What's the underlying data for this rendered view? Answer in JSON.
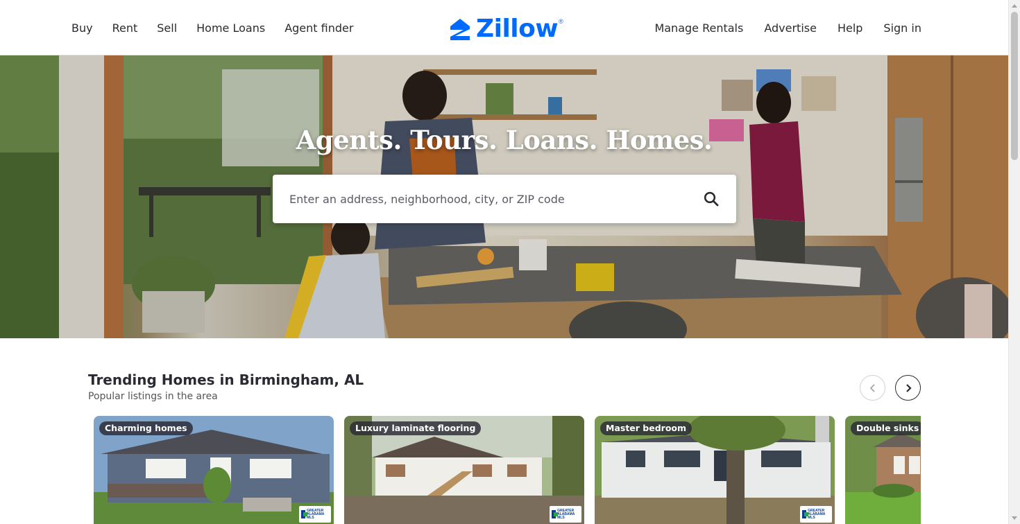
{
  "colors": {
    "brand": "#006aff",
    "text": "#2a2a33",
    "badge_bg": "#2a2a33"
  },
  "header": {
    "nav_left": [
      "Buy",
      "Rent",
      "Sell",
      "Home Loans",
      "Agent finder"
    ],
    "logo_text": "Zillow",
    "logo_mark": "®",
    "nav_right": [
      "Manage Rentals",
      "Advertise",
      "Help",
      "Sign in"
    ]
  },
  "hero": {
    "headline": "Agents. Tours. Loans. Homes.",
    "search": {
      "placeholder": "Enter an address, neighborhood, city, or ZIP code",
      "value": "",
      "icon": "search-icon"
    }
  },
  "trending": {
    "title": "Trending Homes in Birmingham, AL",
    "subtitle": "Popular listings in the area",
    "prev_icon": "chevron-left-icon",
    "next_icon": "chevron-right-icon",
    "cards": [
      {
        "badge": "Charming homes",
        "mls": "GREATER ALABAMA MLS"
      },
      {
        "badge": "Luxury laminate flooring",
        "mls": "GREATER ALABAMA MLS"
      },
      {
        "badge": "Master bedroom",
        "mls": "GREATER ALABAMA MLS"
      },
      {
        "badge": "Double sinks",
        "mls": ""
      }
    ]
  }
}
